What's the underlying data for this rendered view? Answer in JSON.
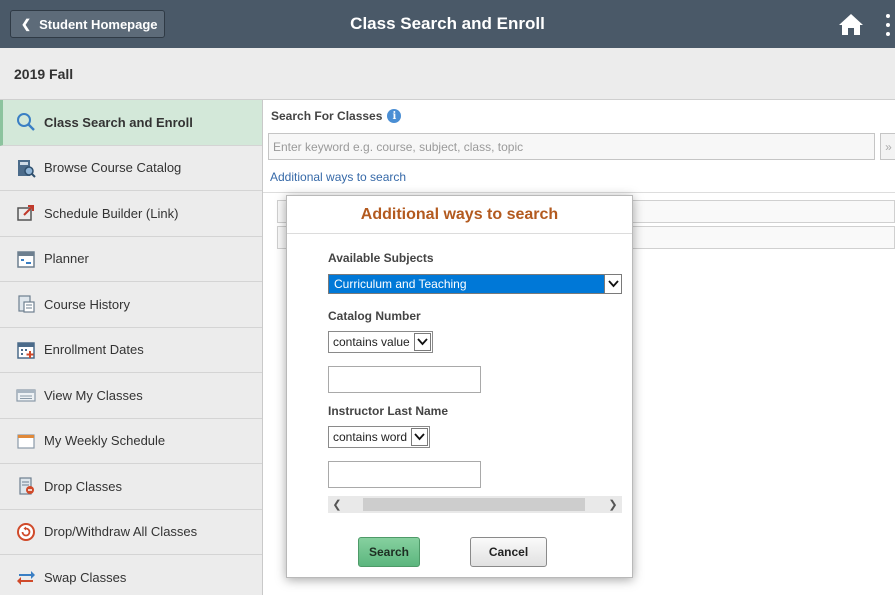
{
  "header": {
    "back_label": "Student Homepage",
    "title": "Class Search and Enroll",
    "back_icon": "chevron-left-icon",
    "home_icon": "home-icon",
    "more_icon": "more-vertical-icon"
  },
  "term": "2019 Fall",
  "sidebar": {
    "items": [
      {
        "label": "Class Search and Enroll",
        "icon": "search-icon",
        "active": true
      },
      {
        "label": "Browse Course Catalog",
        "icon": "catalog-icon"
      },
      {
        "label": "Schedule Builder (Link)",
        "icon": "external-link-icon"
      },
      {
        "label": "Planner",
        "icon": "planner-icon"
      },
      {
        "label": "Course History",
        "icon": "course-history-icon"
      },
      {
        "label": "Enrollment Dates",
        "icon": "calendar-add-icon"
      },
      {
        "label": "View My Classes",
        "icon": "calendar-list-icon"
      },
      {
        "label": "My Weekly Schedule",
        "icon": "weekly-calendar-icon"
      },
      {
        "label": "Drop Classes",
        "icon": "drop-icon"
      },
      {
        "label": "Drop/Withdraw All Classes",
        "icon": "withdraw-icon"
      },
      {
        "label": "Swap Classes",
        "icon": "swap-icon"
      }
    ]
  },
  "main": {
    "search_for_label": "Search For Classes",
    "keyword_placeholder": "Enter keyword e.g. course, subject, class, topic",
    "go_label": "»",
    "additional_link": "Additional ways to search"
  },
  "modal": {
    "title": "Additional ways to search",
    "subjects_label": "Available Subjects",
    "subject_value": "Curriculum and Teaching",
    "catalog_label": "Catalog Number",
    "catalog_op": "contains value",
    "instructor_label": "Instructor Last Name",
    "instructor_op": "contains word",
    "search_button": "Search",
    "cancel_button": "Cancel"
  },
  "colors": {
    "header_bg": "#4a5968",
    "active_nav_bg": "#d3e8d9",
    "modal_title": "#b35a1f",
    "link": "#3669a8",
    "search_button": "#5cb67e",
    "selected_option": "#0078d7"
  }
}
